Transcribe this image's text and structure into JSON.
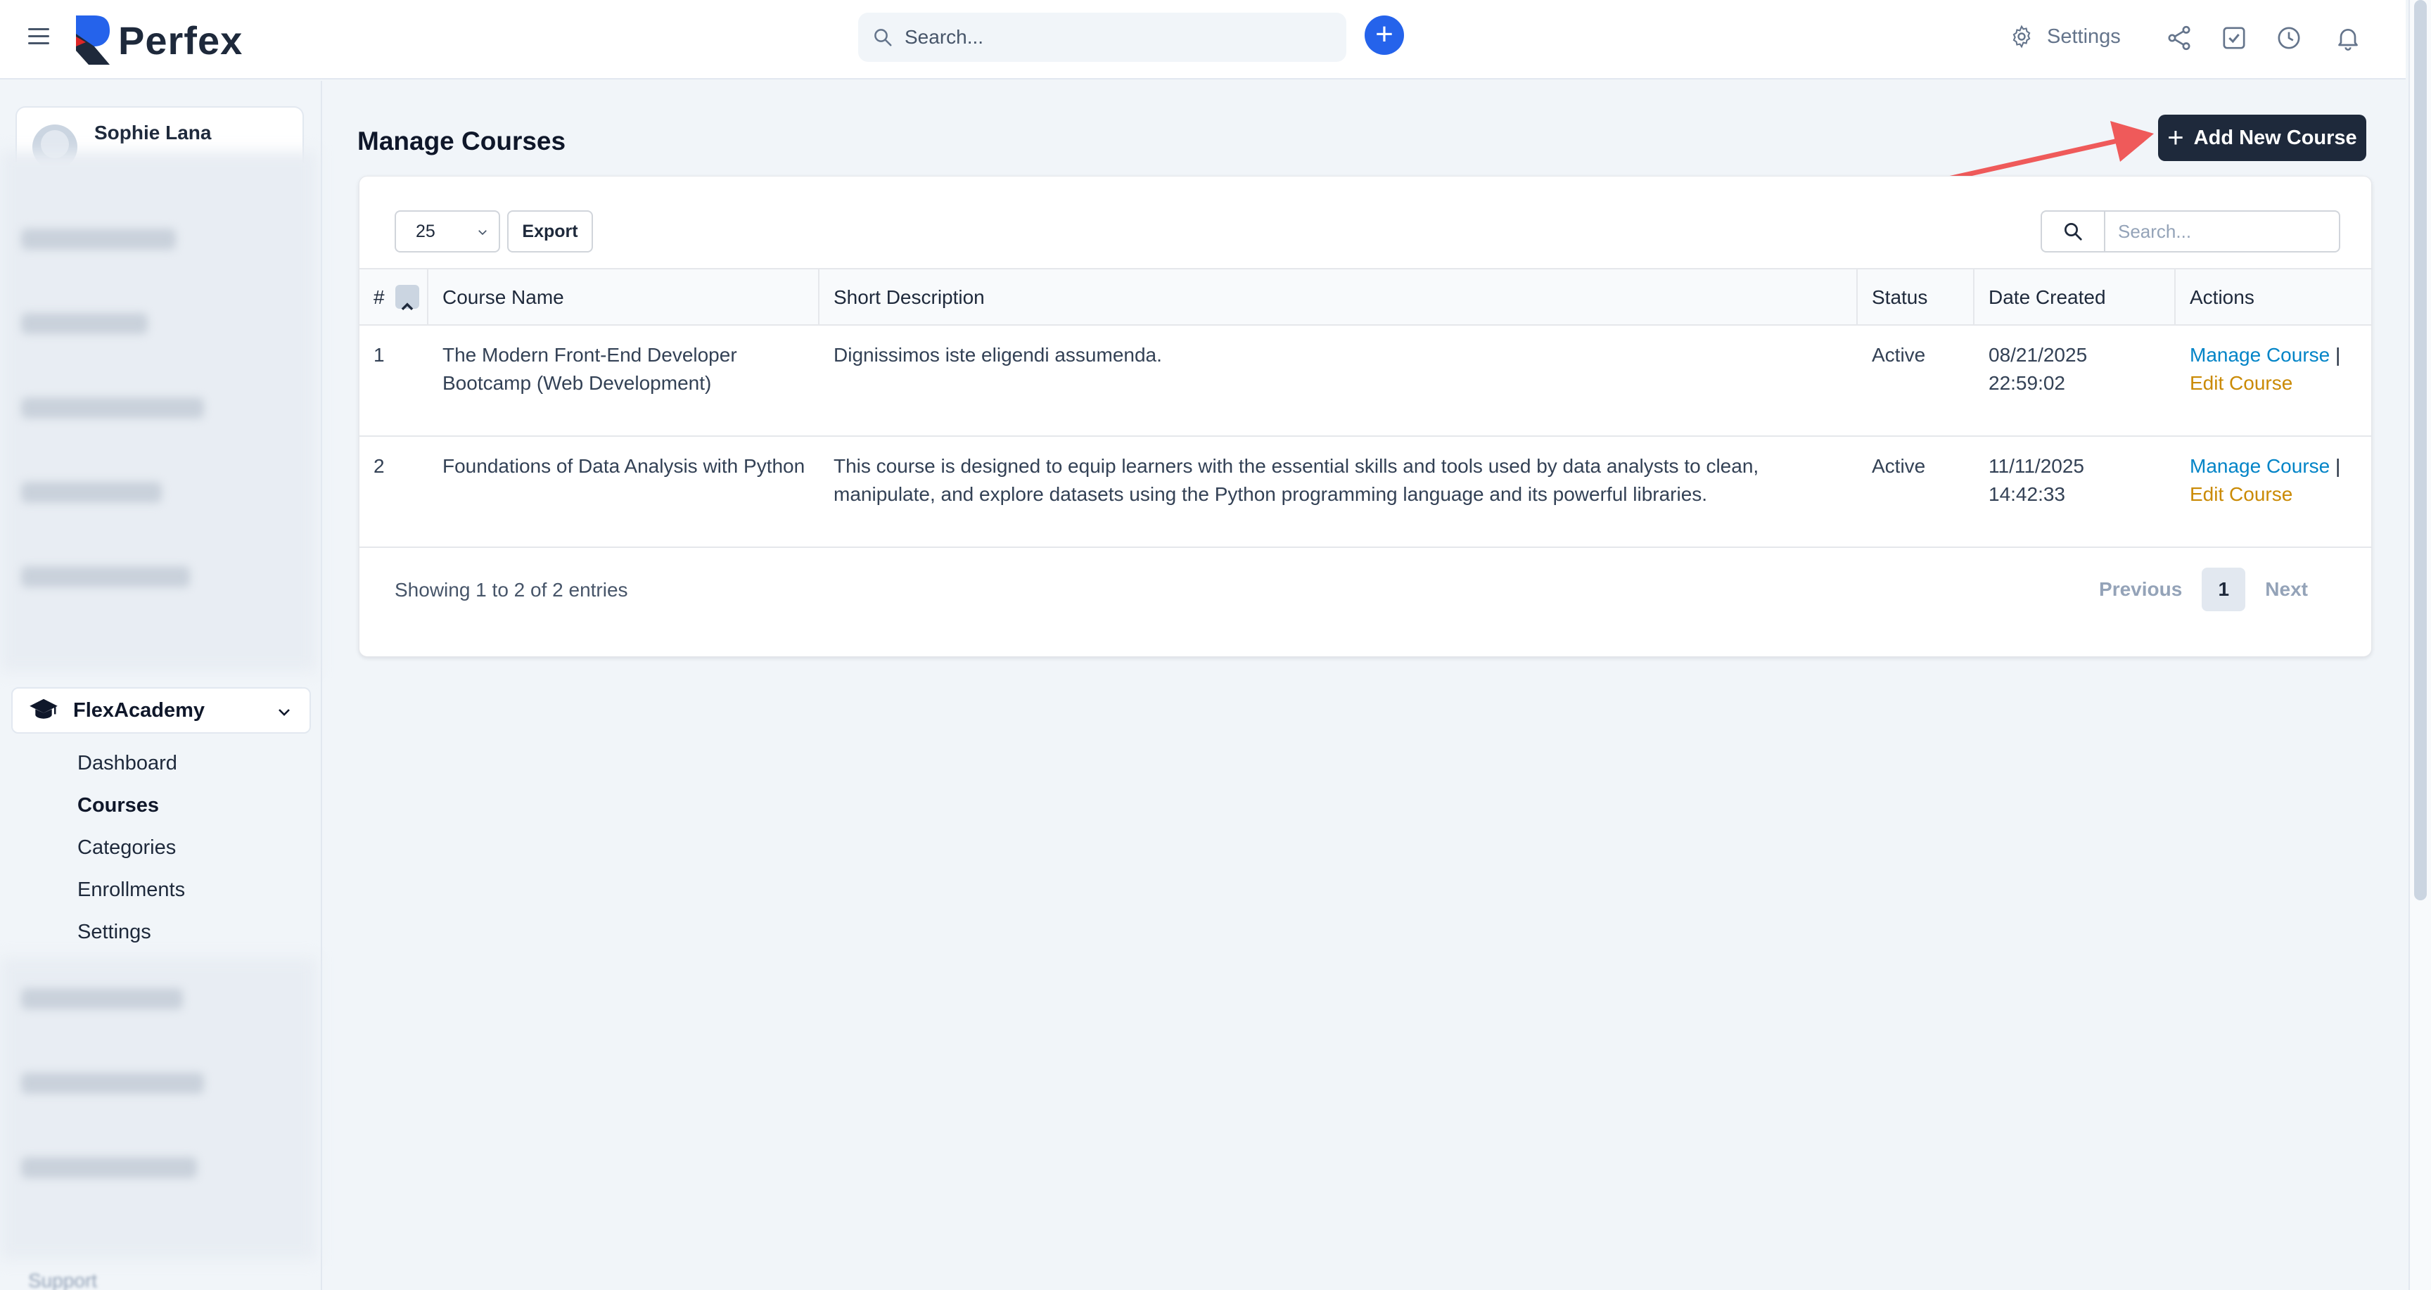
{
  "app": {
    "name": "Perfex",
    "search_placeholder": "Search...",
    "settings_label": "Settings"
  },
  "sidebar": {
    "user_name": "Sophie Lana",
    "module": {
      "title": "FlexAcademy",
      "items": [
        {
          "label": "Dashboard",
          "active": false
        },
        {
          "label": "Courses",
          "active": true
        },
        {
          "label": "Categories",
          "active": false
        },
        {
          "label": "Enrollments",
          "active": false
        },
        {
          "label": "Settings",
          "active": false
        }
      ]
    },
    "support_label": "Support"
  },
  "page": {
    "title": "Manage Courses",
    "add_button_label": "Add New Course"
  },
  "table_controls": {
    "page_size": "25",
    "export_label": "Export",
    "search_placeholder": "Search..."
  },
  "table": {
    "columns": [
      "#",
      "Course Name",
      "Short Description",
      "Status",
      "Date Created",
      "Actions"
    ],
    "rows": [
      {
        "num": "1",
        "course_name": "The Modern Front-End Developer Bootcamp (Web Development)",
        "description": "Dignissimos iste eligendi assumenda.",
        "status": "Active",
        "date": "08/21/2025",
        "time": "22:59:02",
        "action_manage": "Manage Course",
        "action_sep": "|",
        "action_edit": "Edit Course"
      },
      {
        "num": "2",
        "course_name": "Foundations of Data Analysis with Python",
        "description": "This course is designed to equip learners with the essential skills and tools used by data analysts to clean, manipulate, and explore datasets using the Python programming language and its powerful libraries.",
        "status": "Active",
        "date": "11/11/2025",
        "time": "14:42:33",
        "action_manage": "Manage Course",
        "action_sep": "|",
        "action_edit": "Edit Course"
      }
    ]
  },
  "pagination": {
    "info": "Showing 1 to 2 of 2 entries",
    "previous": "Previous",
    "current_page": "1",
    "next": "Next"
  },
  "colors": {
    "primary_dark": "#1e293b",
    "accent_blue": "#2563eb",
    "link_blue": "#0284c7",
    "link_gold": "#ca8a04",
    "annotation_red": "#ef5a5a"
  }
}
